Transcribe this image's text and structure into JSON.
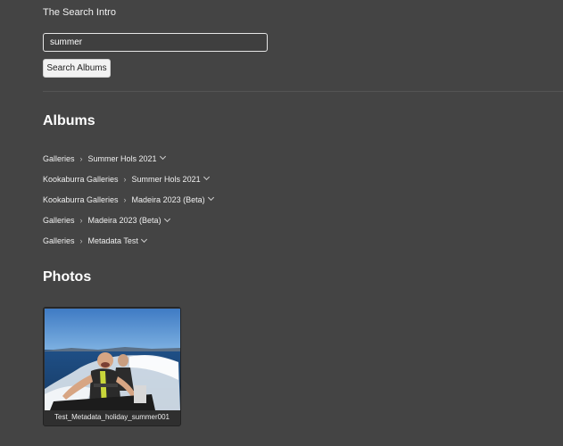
{
  "app": {
    "title": "The Search Intro"
  },
  "search": {
    "value": "summer",
    "button_label": "Search Albums"
  },
  "albums": {
    "heading": "Albums",
    "items": [
      {
        "parent": "Galleries",
        "name": "Summer Hols 2021"
      },
      {
        "parent": "Kookaburra Galleries",
        "name": "Summer Hols 2021"
      },
      {
        "parent": "Kookaburra Galleries",
        "name": "Madeira 2023 (Beta)"
      },
      {
        "parent": "Galleries",
        "name": "Madeira 2023 (Beta)"
      },
      {
        "parent": "Galleries",
        "name": "Metadata Test"
      }
    ]
  },
  "photos": {
    "heading": "Photos",
    "items": [
      {
        "caption": "Test_Metadata_holiday_summer001"
      }
    ]
  },
  "colors": {
    "background": "#444444",
    "text": "#ffffff",
    "button_bg": "#f2f2f2",
    "input_border": "#e6e6e6"
  }
}
